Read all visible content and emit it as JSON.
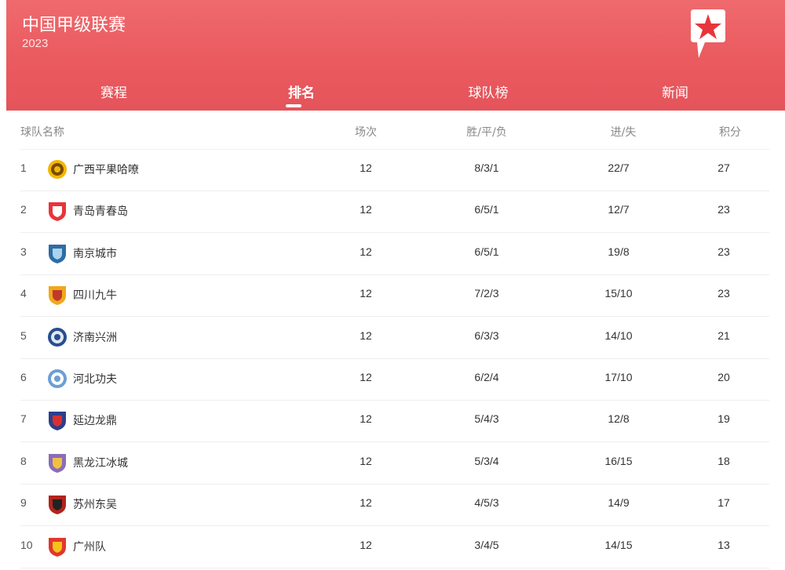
{
  "header": {
    "title": "中国甲级联赛",
    "year": "2023"
  },
  "tabs": [
    {
      "label": "赛程",
      "active": false
    },
    {
      "label": "排名",
      "active": true
    },
    {
      "label": "球队榜",
      "active": false
    },
    {
      "label": "新闻",
      "active": false
    }
  ],
  "columns": {
    "team": "球队名称",
    "played": "场次",
    "wdl": "胜/平/负",
    "goals": "进/失",
    "points": "积分"
  },
  "rows": [
    {
      "rank": "1",
      "team": "广西平果哈嘹",
      "played": "12",
      "wdl": "8/3/1",
      "goals": "22/7",
      "points": "27",
      "crest": "yellow-round-crest-icon",
      "color": "#f2b705",
      "color2": "#7a4a00"
    },
    {
      "rank": "2",
      "team": "青岛青春岛",
      "played": "12",
      "wdl": "6/5/1",
      "goals": "12/7",
      "points": "23",
      "crest": "red-shield-crest-icon",
      "color": "#e8343a",
      "color2": "#ffffff"
    },
    {
      "rank": "3",
      "team": "南京城市",
      "played": "12",
      "wdl": "6/5/1",
      "goals": "19/8",
      "points": "23",
      "crest": "blue-shield-crest-icon",
      "color": "#2e6da4",
      "color2": "#a9d3f0"
    },
    {
      "rank": "4",
      "team": "四川九牛",
      "played": "12",
      "wdl": "7/2/3",
      "goals": "15/10",
      "points": "23",
      "crest": "gold-shield-crest-icon",
      "color": "#f0a81c",
      "color2": "#c0392b"
    },
    {
      "rank": "5",
      "team": "济南兴洲",
      "played": "12",
      "wdl": "6/3/3",
      "goals": "14/10",
      "points": "21",
      "crest": "navy-round-crest-icon",
      "color": "#2a4d8f",
      "color2": "#dfe8f5"
    },
    {
      "rank": "6",
      "team": "河北功夫",
      "played": "12",
      "wdl": "6/2/4",
      "goals": "17/10",
      "points": "20",
      "crest": "lightblue-round-crest-icon",
      "color": "#6b9fd6",
      "color2": "#ffffff"
    },
    {
      "rank": "7",
      "team": "延边龙鼎",
      "played": "12",
      "wdl": "5/4/3",
      "goals": "12/8",
      "points": "19",
      "crest": "blue-red-shield-crest-icon",
      "color": "#2b3f8c",
      "color2": "#d92f2f"
    },
    {
      "rank": "8",
      "team": "黑龙江冰城",
      "played": "12",
      "wdl": "5/3/4",
      "goals": "16/15",
      "points": "18",
      "crest": "purple-shield-crest-icon",
      "color": "#8a6db8",
      "color2": "#f0c040"
    },
    {
      "rank": "9",
      "team": "苏州东吴",
      "played": "12",
      "wdl": "4/5/3",
      "goals": "14/9",
      "points": "17",
      "crest": "darkred-shield-crest-icon",
      "color": "#b3241e",
      "color2": "#222222"
    },
    {
      "rank": "10",
      "team": "广州队",
      "played": "12",
      "wdl": "3/4/5",
      "goals": "14/15",
      "points": "13",
      "crest": "red-shield-crest-icon",
      "color": "#e2372d",
      "color2": "#f6c21c"
    }
  ]
}
